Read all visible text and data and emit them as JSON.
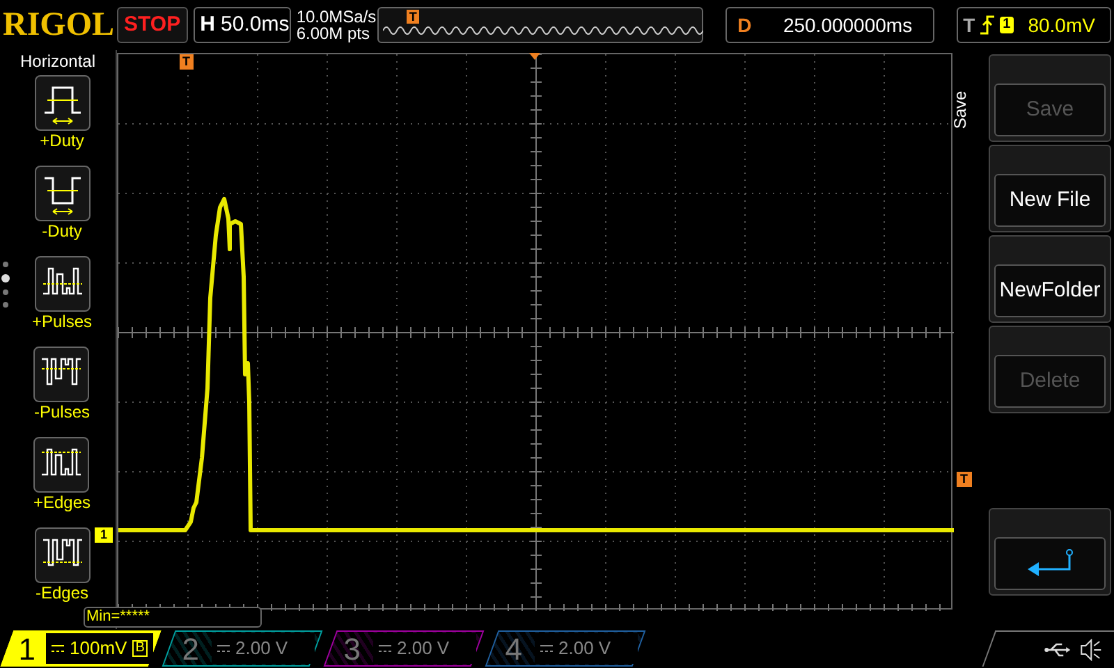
{
  "top_bar": {
    "logo": "RIGOL",
    "run_state": "STOP",
    "timebase": {
      "label": "H",
      "value": "50.0ms"
    },
    "sample_rate": "10.0MSa/s",
    "memory_depth": "6.00M pts",
    "overview_marker": "T",
    "delay": {
      "label": "D",
      "value": "250.000000ms"
    },
    "trigger": {
      "label": "T",
      "source": "1",
      "level": "80.0mV"
    }
  },
  "left_menu": {
    "title": "Horizontal",
    "items": [
      {
        "label": "+Duty"
      },
      {
        "label": "-Duty"
      },
      {
        "label": "+Pulses"
      },
      {
        "label": "-Pulses"
      },
      {
        "label": "+Edges"
      },
      {
        "label": "-Edges"
      }
    ],
    "page_dots": [
      {
        "selected": false
      },
      {
        "selected": true
      },
      {
        "selected": false
      },
      {
        "selected": false
      }
    ]
  },
  "plot": {
    "trigger_marker": "T",
    "level_marker": "T",
    "channel_marker": "1",
    "measurement": "Min=*****"
  },
  "right_menu": {
    "title": "Save",
    "buttons": [
      {
        "label": "Save",
        "disabled": true
      },
      {
        "label": "New File",
        "disabled": false
      },
      {
        "label": "NewFolder",
        "disabled": false
      },
      {
        "label": "Delete",
        "disabled": true
      }
    ]
  },
  "channels": [
    {
      "number": "1",
      "scale": "100mV",
      "badge": "B",
      "active": true,
      "color": "#ffff00"
    },
    {
      "number": "2",
      "scale": "2.00 V",
      "active": false,
      "color": "#00a0a0"
    },
    {
      "number": "3",
      "scale": "2.00 V",
      "active": false,
      "color": "#a000a0"
    },
    {
      "number": "4",
      "scale": "2.00 V",
      "active": false,
      "color": "#2060a0"
    }
  ]
}
